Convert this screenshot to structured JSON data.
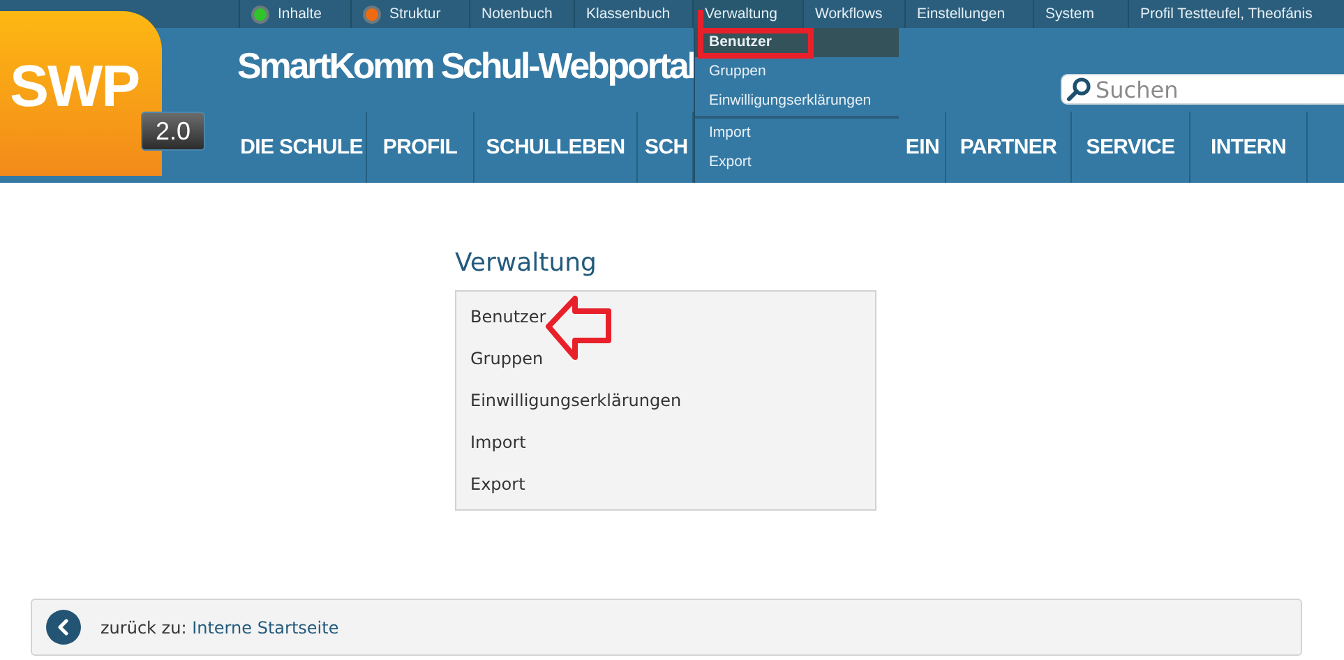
{
  "top_menu": [
    {
      "label": "Inhalte",
      "color": "#2fc42a",
      "selected": false
    },
    {
      "label": "Struktur",
      "color": "#f06a12",
      "selected": false
    },
    {
      "label": "Notenbuch",
      "selected": false
    },
    {
      "label": "Klassenbuch",
      "selected": false
    },
    {
      "label": "Verwaltung",
      "selected": true
    },
    {
      "label": "Workflows",
      "selected": false
    },
    {
      "label": "Einstellungen",
      "selected": false
    },
    {
      "label": "System",
      "selected": false
    },
    {
      "label": "Profil Testteufel, Theofánis",
      "selected": false
    }
  ],
  "dropdown": {
    "groups": [
      [
        {
          "label": "Benutzer",
          "selected": true
        },
        {
          "label": "Gruppen",
          "selected": false
        },
        {
          "label": "Einwilligungserklärungen",
          "selected": false
        }
      ],
      [
        {
          "label": "Import",
          "selected": false
        },
        {
          "label": "Export",
          "selected": false
        }
      ]
    ]
  },
  "logo": {
    "text": "SWP",
    "version": "2.0"
  },
  "site_title": "SmartKomm Schul-Webportal",
  "search": {
    "placeholder": "Suchen"
  },
  "main_nav": [
    "DIE SCHULE",
    "PROFIL",
    "SCHULLEBEN",
    "SCH",
    "EIN",
    "PARTNER",
    "SERVICE",
    "INTERN"
  ],
  "content": {
    "heading": "Verwaltung",
    "items": [
      "Benutzer",
      "Gruppen",
      "Einwilligungserklärungen",
      "Import",
      "Export"
    ]
  },
  "back_link": {
    "prefix": "zurück zu:",
    "label": "Interne Startseite"
  }
}
